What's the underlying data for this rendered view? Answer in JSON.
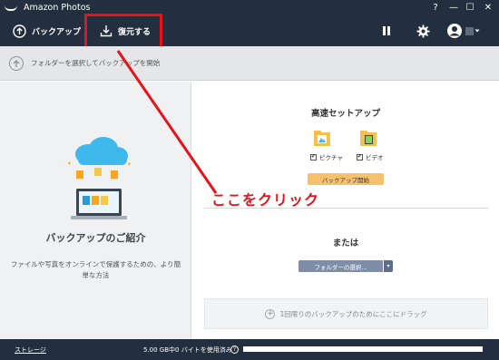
{
  "window": {
    "title": "Amazon Photos",
    "controls": [
      "?",
      "—",
      "☐",
      "✕"
    ]
  },
  "toolbar": {
    "backup_label": "バックアップ",
    "restore_label": "復元する"
  },
  "hint_bar": {
    "text": "フォルダーを選択してバックアップを開始"
  },
  "left_panel": {
    "heading": "バックアップのご紹介",
    "description": "ファイルや写真をオンラインで保護するための、より簡単な方法"
  },
  "right_panel": {
    "fast_setup_title": "高速セットアップ",
    "checkboxes": [
      {
        "label": "ピクチャ",
        "checked": true,
        "check_glyph": "✔"
      },
      {
        "label": "ビデオ",
        "checked": true,
        "check_glyph": "✔"
      }
    ],
    "start_button": "バックアップ開始",
    "or_label": "または",
    "folder_select_button": "フォルダーの選択...",
    "folder_dropdown_glyph": "▾",
    "dropzone_plus": "+",
    "dropzone_text": "1回限りのバックアップのためにここにドラッグ"
  },
  "annotation": {
    "callout": "ここをクリック"
  },
  "status_bar": {
    "storage_link": "ストレージ",
    "usage_text": "5.00 GB中0 バイトを使用済み",
    "help_glyph": "?",
    "usage_fraction": 0.0
  },
  "colors": {
    "dark_bar": "#232f3e",
    "accent_red": "#e3141b",
    "start_button": "#f5c26b",
    "folder_button": "#7e8ea9",
    "progress_fill": "#1aa3e8"
  }
}
